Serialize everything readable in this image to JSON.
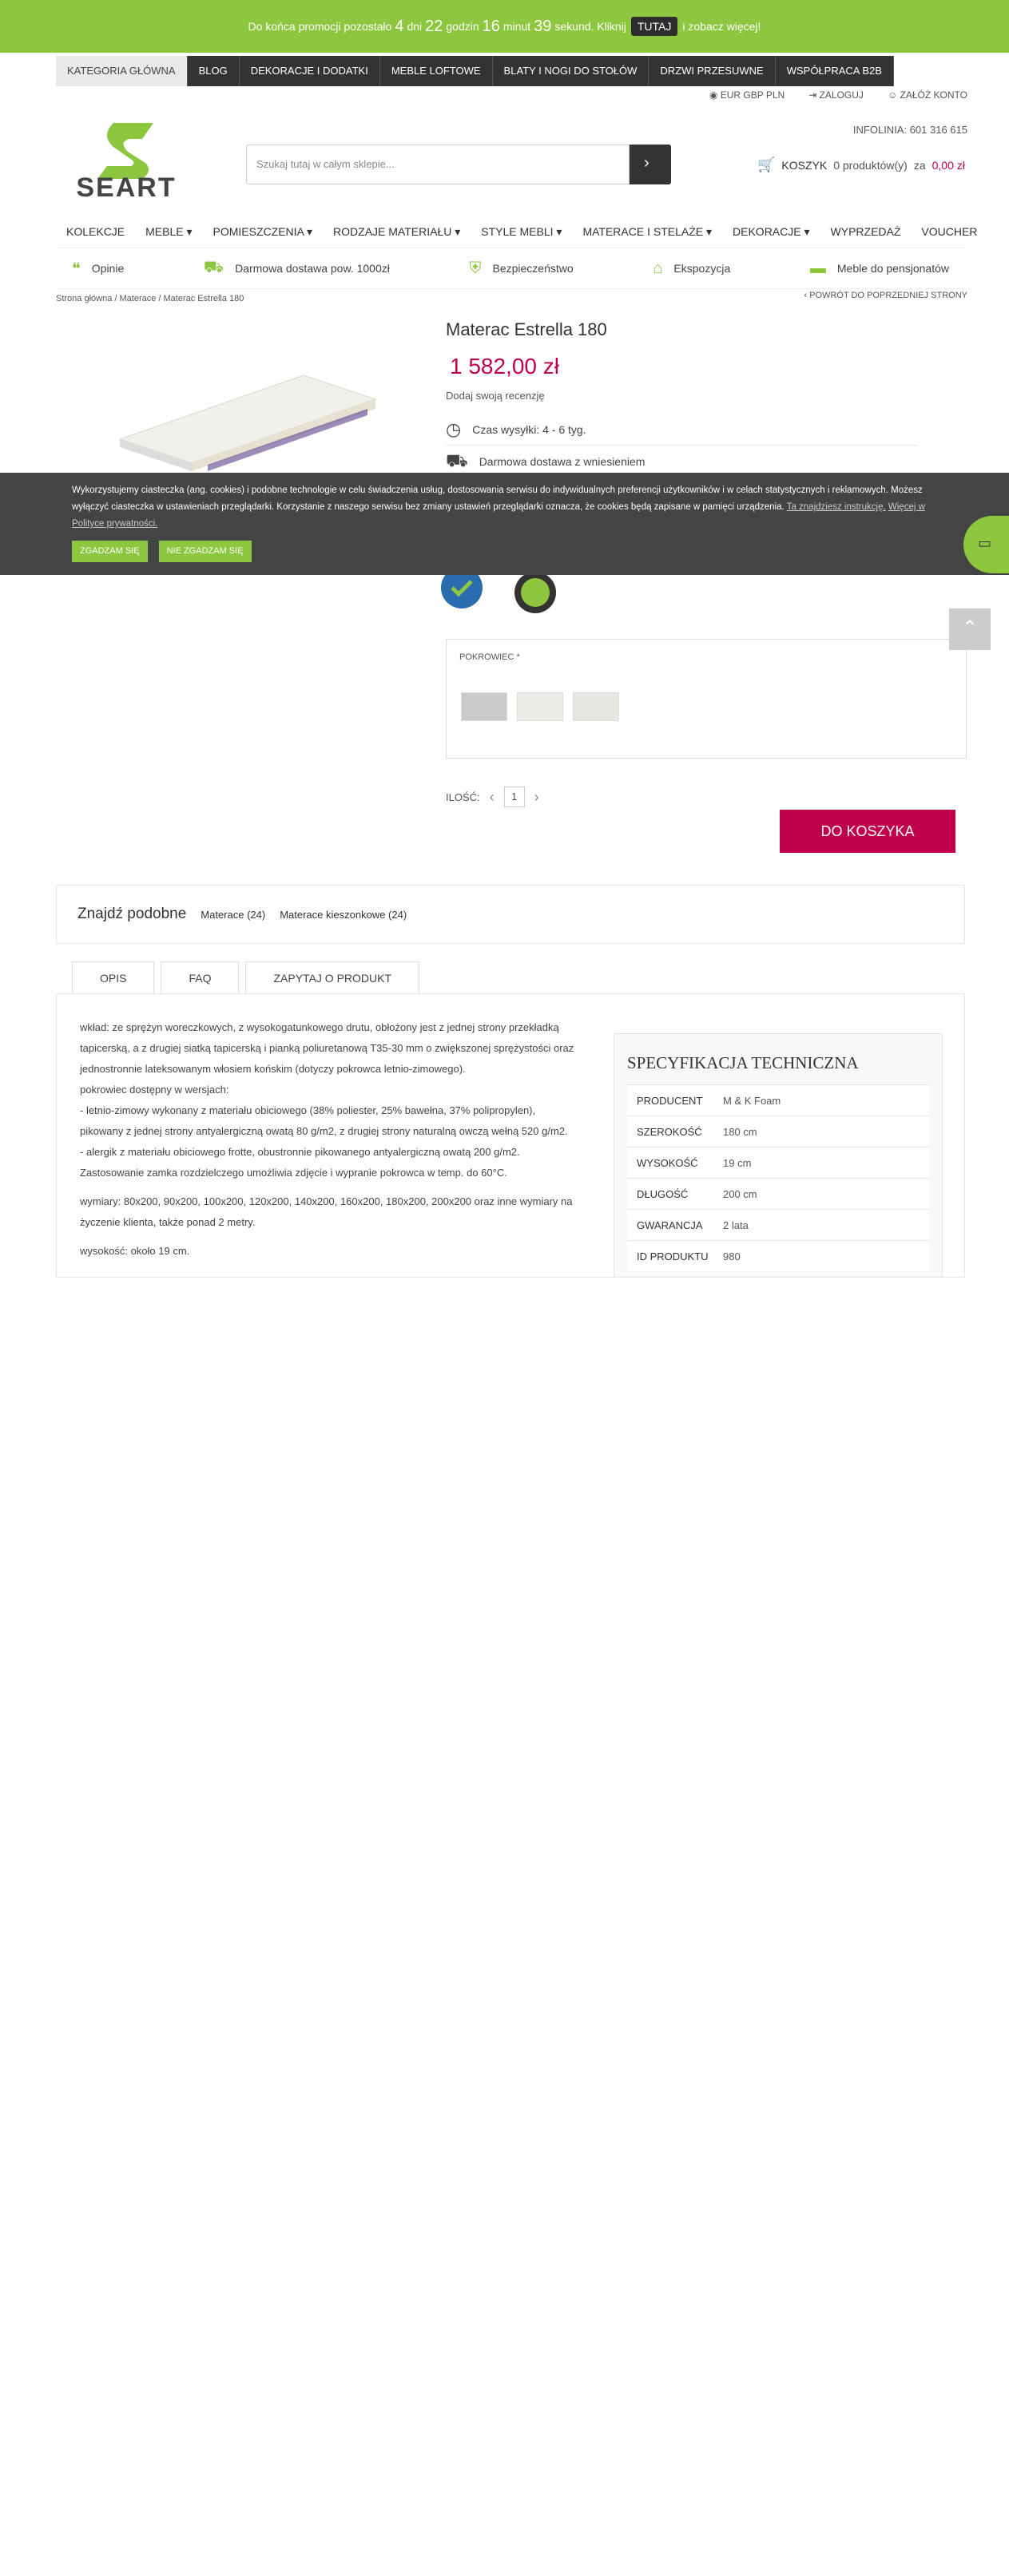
{
  "promo": {
    "prefix": "Do końca promocji pozostało",
    "days": "4",
    "days_label": "dni",
    "hours": "22",
    "hours_label": "godzin",
    "minutes": "16",
    "minutes_label": "minut",
    "seconds": "39",
    "seconds_label": "sekund. Kliknij",
    "link": "TUTAJ",
    "suffix": "i zobacz więcej!"
  },
  "topnav": [
    "KATEGORIA GŁÓWNA",
    "BLOG",
    "DEKORACJE I DODATKI",
    "MEBLE LOFTOWE",
    "BLATY I NOGI DO STOŁÓW",
    "DRZWI PRZESUWNE",
    "WSPÓŁPRACA B2B"
  ],
  "utils": {
    "currency": "EUR GBP PLN",
    "login": "ZALOGUJ",
    "register": "ZAŁÓŻ KONTO"
  },
  "logo": {
    "text": "SEART"
  },
  "search": {
    "placeholder": "Szukaj tutaj w całym sklepie..."
  },
  "infolinia": "INFOLINIA: 601 316 615",
  "cart": {
    "label": "KOSZYK",
    "count": "0 produktów(y)",
    "za": "za",
    "total": "0,00 zł"
  },
  "mainnav": [
    "KOLEKCJE",
    "MEBLE ▾",
    "POMIESZCZENIA ▾",
    "RODZAJE MATERIAŁU ▾",
    "STYLE MEBLI ▾",
    "MATERACE I STELAŻE ▾",
    "DEKORACJE ▾",
    "WYPRZEDAŻ",
    "VOUCHER"
  ],
  "features": [
    "Opinie",
    "Darmowa dostawa pow. 1000zł",
    "Bezpieczeństwo",
    "Ekspozycja",
    "Meble do pensjonatów"
  ],
  "breadcrumb": "Strona główna / Materace / Materac Estrella 180",
  "back": "‹ POWRÓT DO POPRZEDNIEJ STRONY",
  "product": {
    "title": "Materac Estrella 180",
    "price": "1 582,00 zł",
    "review": "Dodaj swoją recenzję",
    "shipping": "Czas wysyłki: 4 - 6 tyg.",
    "delivery": "Darmowa dostawa z wniesieniem",
    "pokrowiec": "POKROWIEC *",
    "qty_label": "ILOŚĆ:",
    "qty": "1",
    "to_cart": "DO KOSZYKA"
  },
  "cookie": {
    "text": "Wykorzystujemy ciasteczka (ang. cookies) i podobne technologie w celu świadczenia usług, dostosowania serwisu do indywidualnych preferencji użytkowników i w celach statystycznych i reklamowych. Możesz wyłączyć ciasteczka w ustawieniach przeglądarki. Korzystanie z naszego serwisu bez zmiany ustawień przeglądarki oznacza, że cookies będą zapisane w pamięci urządzenia.",
    "link1": "Ta znajdziesz instrukcję.",
    "link2": "Więcej w Polityce prywatności.",
    "accept": "ZGADZAM SIĘ",
    "reject": "NIE ZGADZAM SIĘ"
  },
  "similar": {
    "title": "Znajdź podobne",
    "a": "Materace (24)",
    "b": "Materace kieszonkowe (24)"
  },
  "tabs": [
    "OPIS",
    "FAQ",
    "ZAPYTAJ O PRODUKT"
  ],
  "desc": {
    "p1": "wkład: ze sprężyn woreczkowych, z wysokogatunkowego drutu, obłożony jest z jednej strony przekładką tapicerską, a z drugiej siatką tapicerską i pianką poliuretanową T35-30 mm o zwiększonej sprężystości oraz jednostronnie lateksowanym włosiem końskim (dotyczy pokrowca letnio-zimowego).",
    "p2": "pokrowiec dostępny w wersjach:",
    "p3": "- letnio-zimowy wykonany z materiału obiciowego (38% poliester, 25% bawełna, 37% polipropylen), pikowany z jednej strony antyalergiczną owatą 80 g/m2, z drugiej strony naturalną owczą wełną 520 g/m2.",
    "p4": "- alergik z materiału obiciowego frotte, obustronnie pikowanego antyalergiczną owatą 200 g/m2. Zastosowanie zamka rozdzielczego umożliwia zdjęcie i wypranie pokrowca w temp. do 60°C.",
    "p5": "wymiary: 80x200, 90x200, 100x200, 120x200, 140x200, 160x200, 180x200, 200x200 oraz inne wymiary na życzenie klienta, także ponad 2 metry.",
    "p6": "wysokość: około 19 cm."
  },
  "spec": {
    "title": "SPECYFIKACJA TECHNICZNA",
    "rows": [
      [
        "PRODUCENT",
        "M & K Foam"
      ],
      [
        "SZEROKOŚĆ",
        "180 cm"
      ],
      [
        "WYSOKOŚĆ",
        "19 cm"
      ],
      [
        "DŁUGOŚĆ",
        "200 cm"
      ],
      [
        "GWARANCJA",
        "2 lata"
      ],
      [
        "ID PRODUKTU",
        "980"
      ]
    ]
  }
}
